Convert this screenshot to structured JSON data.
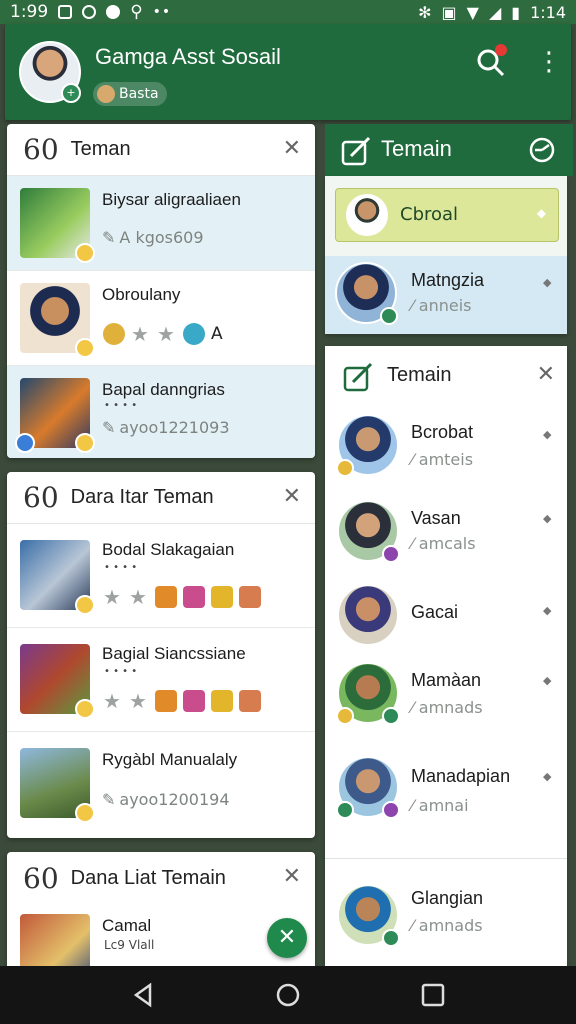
{
  "status_bar": {
    "time": "1:99",
    "battery": "1:14"
  },
  "header": {
    "title": "Gamga Asst Sosail",
    "chip": "Basta",
    "colors": {
      "primary": "#1f6b3d",
      "accent": "#e53935"
    }
  },
  "left_cards": [
    {
      "num": "60",
      "title": "Teman",
      "rows": [
        {
          "name": "Biysar aligraaliaen",
          "sub": "A kgos609",
          "kind": "sub",
          "highlight": true
        },
        {
          "name": "Obroulany",
          "kind": "stars",
          "letter": "A",
          "highlight": false
        },
        {
          "name": "Bapal danngrias",
          "tiny": "• • • •",
          "sub": "ayoo1221093",
          "kind": "sub",
          "highlight": true
        }
      ]
    },
    {
      "num": "60",
      "title": "Dara Itar Teman",
      "rows": [
        {
          "name": "Bodal Slakagaian",
          "tiny": "• • • •",
          "kind": "icons",
          "highlight": false
        },
        {
          "name": "Bagial Siancssiane",
          "tiny": "• • • •",
          "kind": "icons",
          "highlight": false
        },
        {
          "name": "Rygàbl Manualaly",
          "sub": "ayoo1200194",
          "kind": "sub",
          "highlight": false
        }
      ]
    },
    {
      "num": "60",
      "title": "Dana Liat Temain",
      "rows": [
        {
          "name": "Camal",
          "tiny": "Lc9 Vlall",
          "kind": "partial",
          "highlight": false
        }
      ]
    }
  ],
  "right_panel": {
    "title": "Temain",
    "chroal": "Cbroal",
    "matngzia": {
      "name": "Matngzia",
      "sub": "anneis"
    },
    "list": {
      "title": "Temain",
      "people": [
        {
          "name": "Bcrobat",
          "sub": "amteis"
        },
        {
          "name": "Vasan",
          "sub": "amcals"
        },
        {
          "name": "Gacai",
          "sub": ""
        },
        {
          "name": "Mamàan",
          "sub": "amnads"
        },
        {
          "name": "Manadapian",
          "sub": "amnai"
        },
        {
          "name": "Glangian",
          "sub": "amnads"
        }
      ]
    }
  }
}
